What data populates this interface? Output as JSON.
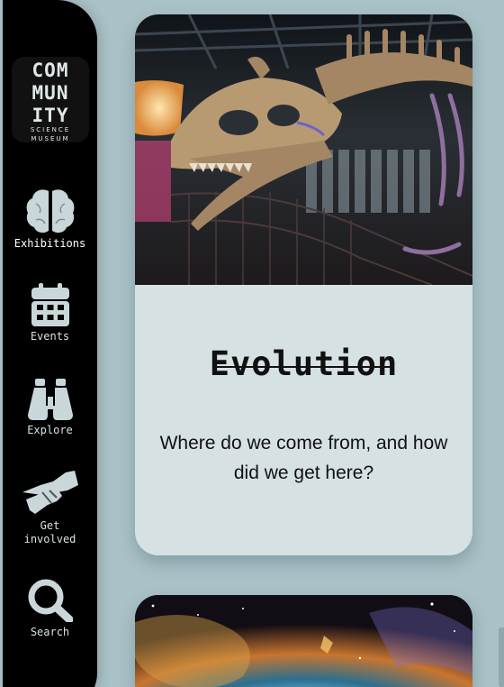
{
  "logo": {
    "line1": "COM",
    "line2": "MUN",
    "line3": "ITY",
    "line4": "SCIENCE",
    "line5": "MUSEUM"
  },
  "nav": {
    "exhibitions": "Exhibitions",
    "events": "Events",
    "explore": "Explore",
    "get_involved_1": "Get",
    "get_involved_2": "involved",
    "search": "Search"
  },
  "cards": [
    {
      "title": "Evolution",
      "description": "Where do we come from, and how did we get here?",
      "image": "dinosaur-skeleton-exhibit"
    },
    {
      "image": "nebula-space-image"
    }
  ],
  "colors": {
    "background": "#a9c2c7",
    "sidebar": "#000000",
    "card": "#d6e1e3",
    "icon": "#c9d7da"
  },
  "icons": [
    "brain-icon",
    "calendar-icon",
    "binoculars-icon",
    "handshake-icon",
    "search-icon"
  ]
}
